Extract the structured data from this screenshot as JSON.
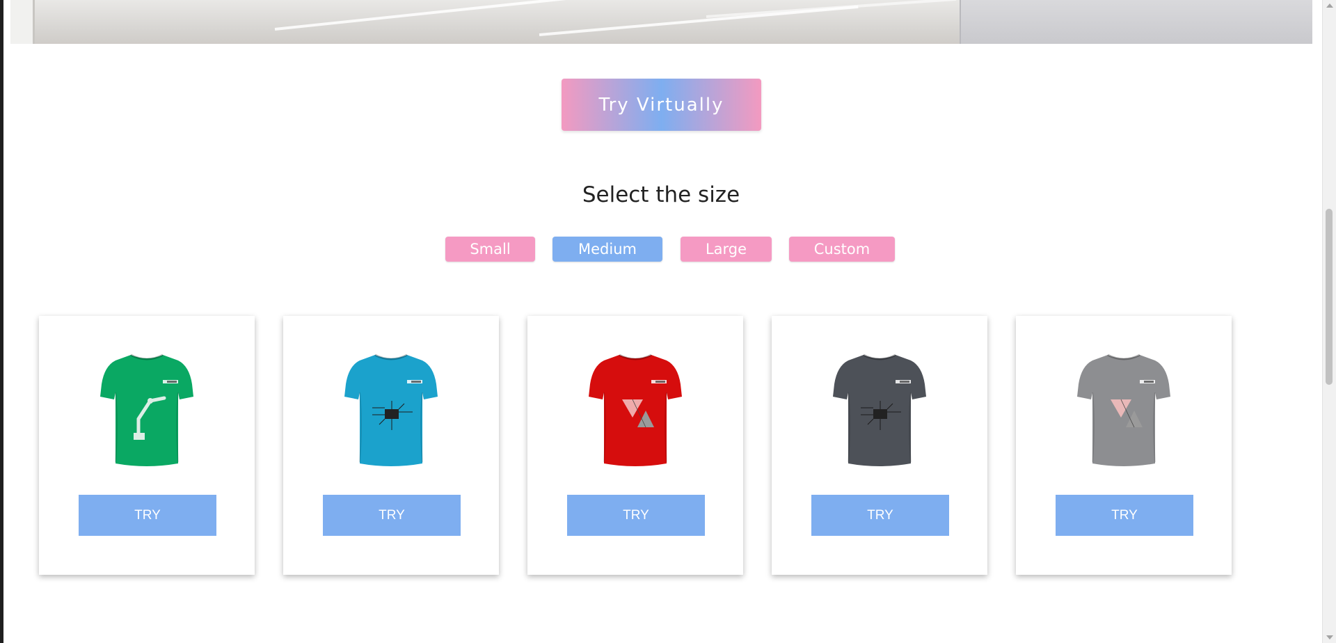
{
  "primary_action": {
    "label": "Try Virtually"
  },
  "size_section": {
    "heading": "Select the size",
    "options": [
      {
        "label": "Small",
        "selected": false
      },
      {
        "label": "Medium",
        "selected": true
      },
      {
        "label": "Large",
        "selected": false
      },
      {
        "label": "Custom",
        "selected": false
      }
    ]
  },
  "products": [
    {
      "color": "#0aa863",
      "graphic": "robot-arm",
      "try_label": "TRY"
    },
    {
      "color": "#1ba2cc",
      "graphic": "circuit-chip",
      "try_label": "TRY"
    },
    {
      "color": "#d60d0d",
      "graphic": "triangles",
      "try_label": "TRY"
    },
    {
      "color": "#4d5158",
      "graphic": "circuit-chip",
      "try_label": "TRY"
    },
    {
      "color": "#8d8e91",
      "graphic": "triangles",
      "try_label": "TRY"
    }
  ],
  "colors": {
    "pink": "#f59ac3",
    "blue": "#7eaef0"
  }
}
